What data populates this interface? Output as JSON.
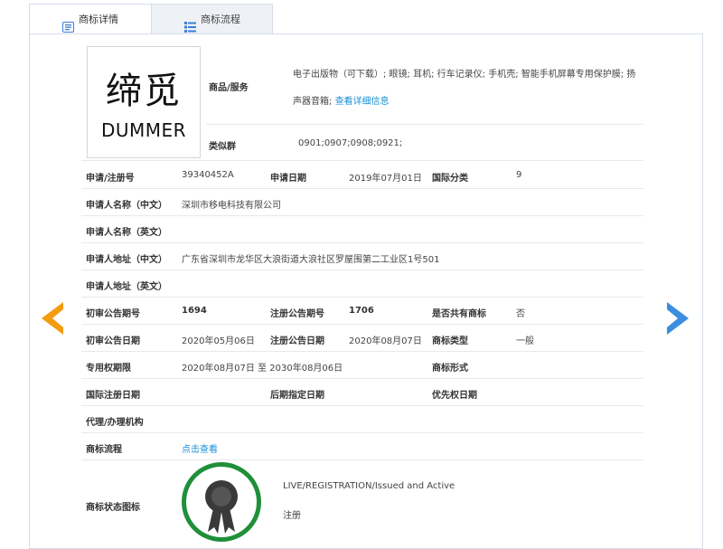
{
  "tabs": [
    {
      "label": "商标详情",
      "icon": "document-icon",
      "active": true
    },
    {
      "label": "商标流程",
      "icon": "list-icon",
      "active": false
    }
  ],
  "logo": {
    "cn": "缔觅",
    "en": "DUMMER"
  },
  "goods": {
    "label": "商品/服务",
    "line1": "电子出版物（可下载）; 眼镜; 耳机; 行车记录仪; 手机壳; 智能手机屏幕专用保护膜; 扬",
    "line2": "声器音箱;",
    "more_link": "查看详细信息"
  },
  "similar": {
    "label": "类似群",
    "value": "0901;0907;0908;0921;"
  },
  "rows": {
    "reg_no": {
      "label": "申请/注册号",
      "value": "39340452A"
    },
    "app_date": {
      "label": "申请日期",
      "value": "2019年07月01日"
    },
    "intl_class": {
      "label": "国际分类",
      "value": "9"
    },
    "applicant_cn": {
      "label": "申请人名称（中文）",
      "value": "深圳市移电科技有限公司"
    },
    "applicant_en": {
      "label": "申请人名称（英文）",
      "value": ""
    },
    "address_cn": {
      "label": "申请人地址（中文）",
      "value": "广东省深圳市龙华区大浪街道大浪社区罗屋围第二工业区1号501"
    },
    "address_en": {
      "label": "申请人地址（英文）",
      "value": ""
    },
    "prelim_issue": {
      "label": "初审公告期号",
      "value": "1694"
    },
    "reg_issue": {
      "label": "注册公告期号",
      "value": "1706"
    },
    "shared": {
      "label": "是否共有商标",
      "value": "否"
    },
    "prelim_date": {
      "label": "初审公告日期",
      "value": "2020年05月06日"
    },
    "reg_date": {
      "label": "注册公告日期",
      "value": "2020年08月07日"
    },
    "tm_type": {
      "label": "商标类型",
      "value": "一般"
    },
    "exclusive_period": {
      "label": "专用权期限",
      "value": "2020年08月07日 至 2030年08月06日"
    },
    "tm_form": {
      "label": "商标形式",
      "value": ""
    },
    "intl_reg_date": {
      "label": "国际注册日期",
      "value": ""
    },
    "later_date": {
      "label": "后期指定日期",
      "value": ""
    },
    "priority_date": {
      "label": "优先权日期",
      "value": ""
    },
    "agent": {
      "label": "代理/办理机构",
      "value": ""
    },
    "process": {
      "label": "商标流程",
      "link": "点击查看"
    },
    "status": {
      "label": "商标状态图标",
      "line1": "LIVE/REGISTRATION/Issued and Active",
      "line2": "注册"
    }
  },
  "colors": {
    "accent": "#1a8fd6",
    "prev_arrow": "#f39c12",
    "next_arrow": "#3a8ee0",
    "badge": "#1f8f3a"
  }
}
